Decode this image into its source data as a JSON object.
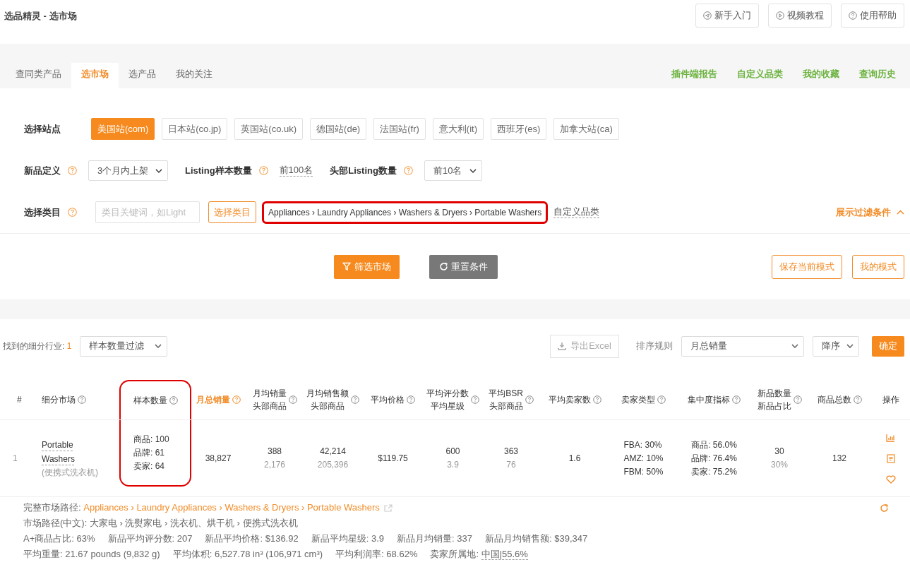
{
  "app_title": "选品精灵 - 选市场",
  "header_buttons": [
    "新手入门",
    "视频教程",
    "使用帮助"
  ],
  "nav_tabs": [
    {
      "label": "查同类产品",
      "selected": false
    },
    {
      "label": "选市场",
      "selected": true
    },
    {
      "label": "选产品",
      "selected": false
    },
    {
      "label": "我的关注",
      "selected": false
    }
  ],
  "nav_links": [
    "插件端报告",
    "自定义品类",
    "我的收藏",
    "查询历史"
  ],
  "filters": {
    "site": {
      "label": "选择站点",
      "options": [
        {
          "label": "美国站(com)",
          "selected": true
        },
        {
          "label": "日本站(co.jp)",
          "selected": false
        },
        {
          "label": "英国站(co.uk)",
          "selected": false
        },
        {
          "label": "德国站(de)",
          "selected": false
        },
        {
          "label": "法国站(fr)",
          "selected": false
        },
        {
          "label": "意大利(it)",
          "selected": false
        },
        {
          "label": "西班牙(es)",
          "selected": false
        },
        {
          "label": "加拿大站(ca)",
          "selected": false
        }
      ]
    },
    "new_def": {
      "label": "新品定义",
      "value": "3个月内上架"
    },
    "sample_count": {
      "label": "Listing样本数量",
      "value": "前100名"
    },
    "head_count": {
      "label": "头部Listing数量",
      "value": "前10名"
    },
    "category": {
      "label": "选择类目",
      "placeholder": "类目关键词，如Light",
      "button": "选择类目",
      "path": "Appliances › Laundry Appliances › Washers & Dryers › Portable Washers",
      "highlighted": true,
      "custom_link": "自定义品类"
    },
    "toggle": "展示过滤条件"
  },
  "actions": {
    "filter": "筛选市场",
    "reset": "重置条件",
    "save": "保存当前模式",
    "mine": "我的模式"
  },
  "results": {
    "found_label": "找到的细分行业:",
    "found_count": "1",
    "sample_filter": "样本数量过滤",
    "export": "导出Excel",
    "sort_label": "排序规则",
    "sort_value": "月总销量",
    "order": "降序",
    "confirm": "确定"
  },
  "table": {
    "columns": [
      {
        "lines": [
          "#"
        ],
        "help": false,
        "sorted": false,
        "highlighted": false
      },
      {
        "lines": [
          "细分市场"
        ],
        "help": true,
        "sorted": false,
        "highlighted": false
      },
      {
        "lines": [
          "样本数量"
        ],
        "help": true,
        "sorted": false,
        "highlighted": true
      },
      {
        "lines": [
          "月总销量"
        ],
        "help": true,
        "sorted": true,
        "highlighted": false
      },
      {
        "lines": [
          "月均销量",
          "头部商品"
        ],
        "help": true,
        "sorted": false,
        "highlighted": false
      },
      {
        "lines": [
          "月均销售额",
          "头部商品"
        ],
        "help": true,
        "sorted": false,
        "highlighted": false
      },
      {
        "lines": [
          "平均价格"
        ],
        "help": true,
        "sorted": false,
        "highlighted": false
      },
      {
        "lines": [
          "平均评分数",
          "平均星级"
        ],
        "help": true,
        "sorted": false,
        "highlighted": false
      },
      {
        "lines": [
          "平均BSR",
          "头部商品"
        ],
        "help": true,
        "sorted": false,
        "highlighted": false
      },
      {
        "lines": [
          "平均卖家数"
        ],
        "help": true,
        "sorted": false,
        "highlighted": false
      },
      {
        "lines": [
          "卖家类型"
        ],
        "help": true,
        "sorted": false,
        "highlighted": false
      },
      {
        "lines": [
          "集中度指标"
        ],
        "help": true,
        "sorted": false,
        "highlighted": false
      },
      {
        "lines": [
          "新品数量",
          "新品占比"
        ],
        "help": true,
        "sorted": false,
        "highlighted": false
      },
      {
        "lines": [
          "商品总数"
        ],
        "help": true,
        "sorted": false,
        "highlighted": false
      },
      {
        "lines": [
          "操作"
        ],
        "help": false,
        "sorted": false,
        "highlighted": false
      }
    ],
    "rows": [
      {
        "cells": [
          {
            "kind": "index",
            "value": "1"
          },
          {
            "kind": "market",
            "name": "Portable Washers",
            "sub": "(便携式洗衣机)"
          },
          {
            "kind": "lines",
            "lines": [
              "商品: 100",
              "品牌: 61",
              "卖家: 64"
            ]
          },
          {
            "kind": "text",
            "value": "38,827"
          },
          {
            "kind": "pair",
            "main": "388",
            "sub": "2,176"
          },
          {
            "kind": "pair",
            "main": "42,214",
            "sub": "205,396"
          },
          {
            "kind": "text",
            "value": "$119.75"
          },
          {
            "kind": "pair",
            "main": "600",
            "sub": "3.9"
          },
          {
            "kind": "pair",
            "main": "363",
            "sub": "76"
          },
          {
            "kind": "text",
            "value": "1.6"
          },
          {
            "kind": "lines",
            "lines": [
              "FBA: 30%",
              "AMZ: 10%",
              "FBM: 50%"
            ]
          },
          {
            "kind": "lines",
            "lines": [
              "商品: 56.0%",
              "品牌: 76.4%",
              "卖家: 75.2%"
            ]
          },
          {
            "kind": "pair",
            "main": "30",
            "sub": "30%"
          },
          {
            "kind": "text",
            "value": "132"
          },
          {
            "kind": "actions"
          }
        ]
      }
    ]
  },
  "details": {
    "path_label": "完整市场路径:",
    "path": "Appliances › Laundry Appliances › Washers & Dryers › Portable Washers",
    "cn_path": "市场路径(中文): 大家电 › 洗熨家电 › 洗衣机、烘干机 › 便携式洗衣机",
    "stats": [
      [
        {
          "label": "A+商品占比:",
          "value": "63%",
          "link": false
        },
        {
          "label": "新品平均评分数:",
          "value": "207",
          "link": false
        },
        {
          "label": "新品平均价格:",
          "value": "$136.92",
          "link": false
        },
        {
          "label": "新品平均星级:",
          "value": "3.9",
          "link": false
        },
        {
          "label": "新品月均销量:",
          "value": "337",
          "link": false
        },
        {
          "label": "新品月均销售额:",
          "value": "$39,347",
          "link": false
        }
      ],
      [
        {
          "label": "平均重量:",
          "value": "21.67 pounds (9,832 g)",
          "link": false
        },
        {
          "label": "平均体积:",
          "value": "6,527.78 in³ (106,971 cm³)",
          "link": false
        },
        {
          "label": "平均利润率:",
          "value": "68.62%",
          "link": false
        },
        {
          "label": "卖家所属地:",
          "value": "中国|55.6%",
          "link": true
        }
      ]
    ]
  }
}
